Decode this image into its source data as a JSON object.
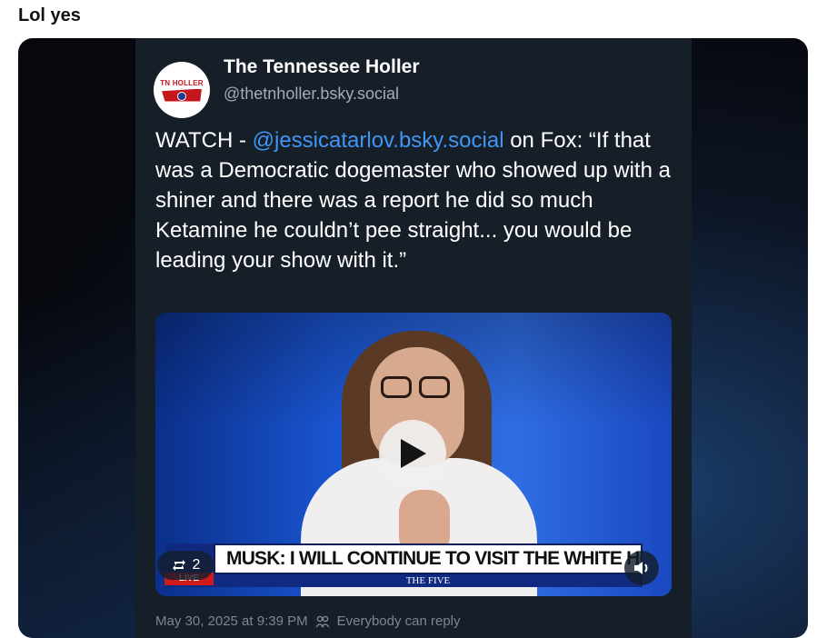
{
  "caption": "Lol yes",
  "post": {
    "author_name": "The Tennessee Holler",
    "author_handle": "@thetnholler.bsky.social",
    "avatar_text": "TN HOLLER",
    "text_prefix": "WATCH - ",
    "mention": "@jessicatarlov.bsky.social",
    "text_suffix": "  on Fox: “If that was a Democratic dogemaster who showed up with a shiner and there was a report he did so much Ketamine he couldn’t pee straight... you would be leading your show with it.”",
    "video": {
      "banner_text": "MUSK: I WILL CONTINUE TO VISIT THE WHITE HOUSE",
      "show_name": "THE FIVE",
      "live_label": "LIVE",
      "repost_count": "2",
      "play_icon": "play-icon",
      "mute_icon": "speaker-icon"
    },
    "meta": {
      "date": "May 30, 2025 at 9:39 PM",
      "reply_setting": "Everybody can reply"
    }
  },
  "colors": {
    "mention": "#3f96f4",
    "card_bg": "#161e28",
    "live_red": "#d11a1a",
    "fox_blue": "#0f2a80"
  }
}
